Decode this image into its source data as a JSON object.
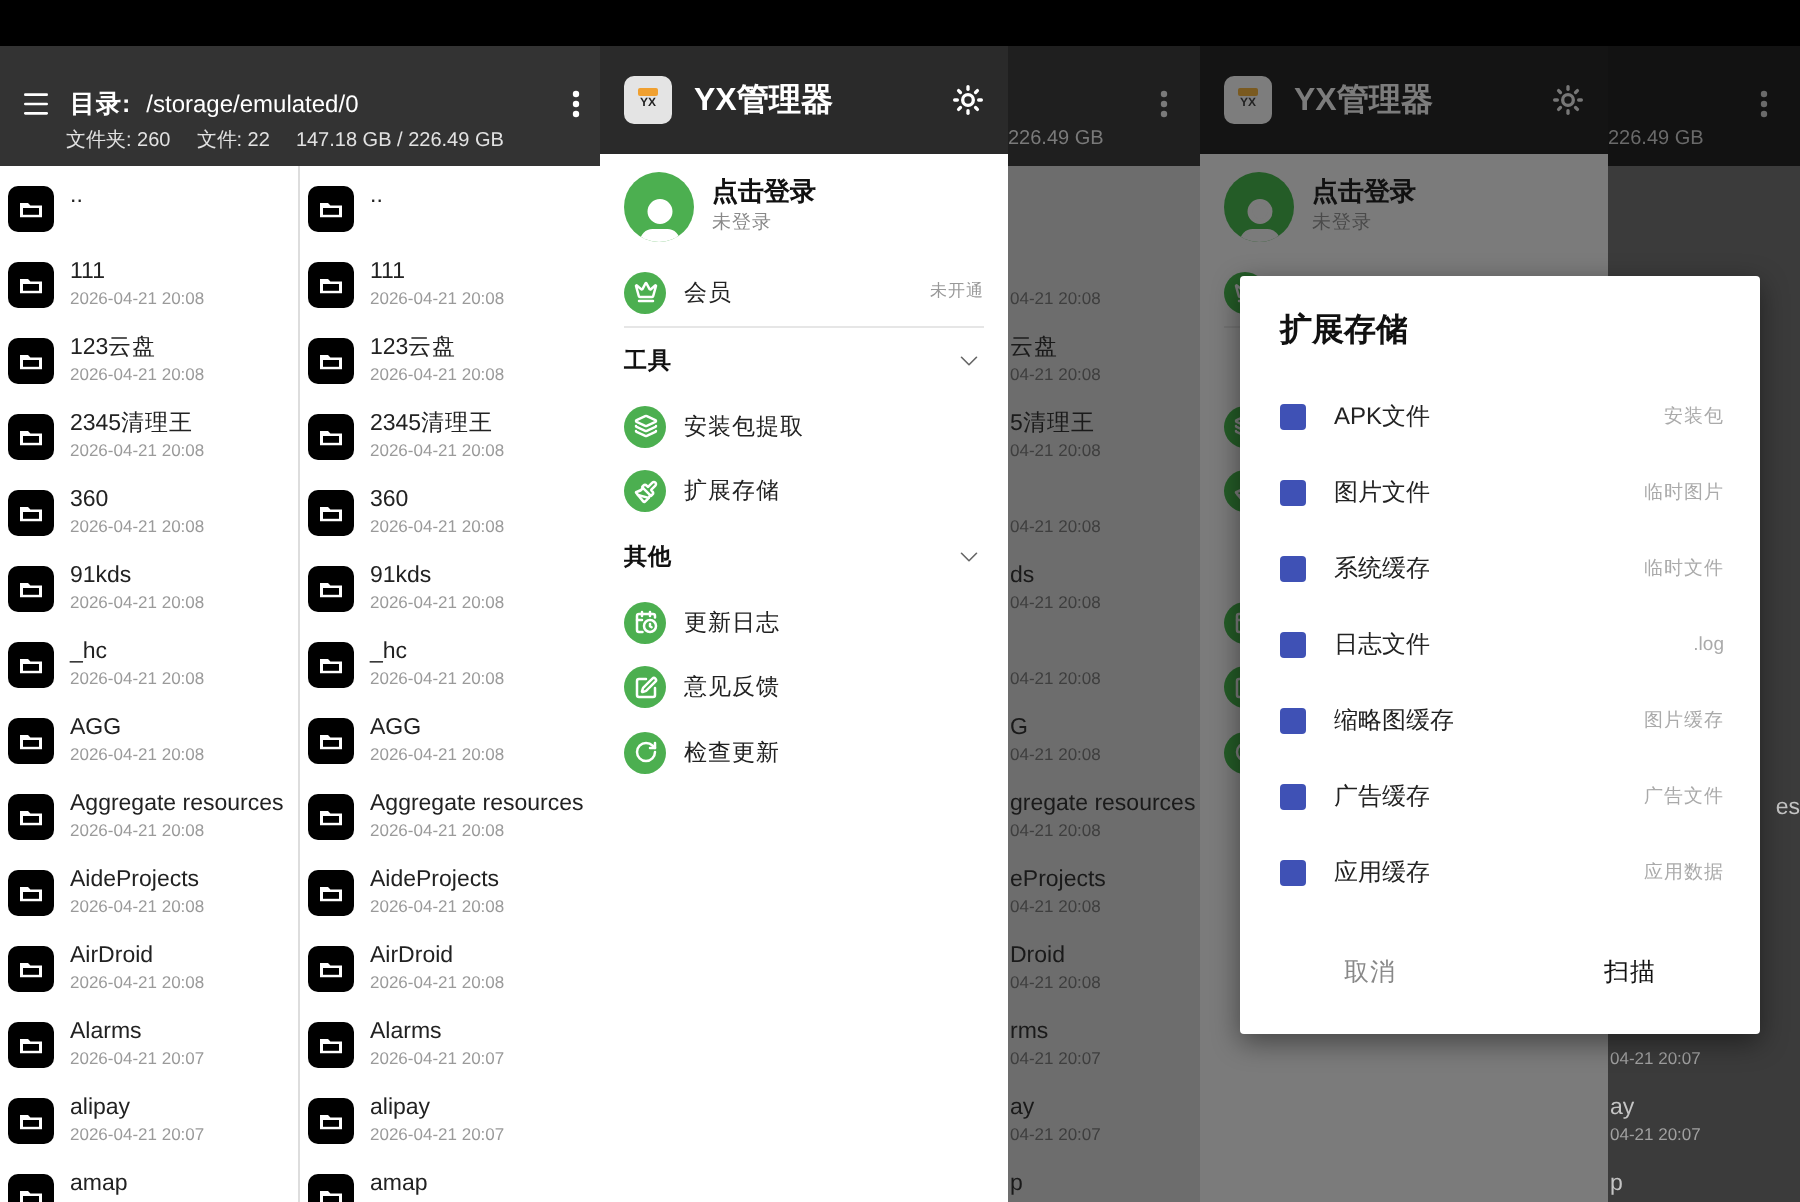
{
  "file_manager_screen": {
    "header": {
      "label": "目录:",
      "path": "/storage/emulated/0",
      "folders": "文件夹: 260",
      "files": "文件: 22",
      "storage": "147.18 GB / 226.49 GB"
    },
    "panes": [
      {
        "items": [
          {
            "name": ".."
          },
          {
            "name": "111",
            "date": "2026-04-21 20:08"
          },
          {
            "name": "123云盘",
            "date": "2026-04-21 20:08"
          },
          {
            "name": "2345清理王",
            "date": "2026-04-21 20:08"
          },
          {
            "name": "360",
            "date": "2026-04-21 20:08"
          },
          {
            "name": "91kds",
            "date": "2026-04-21 20:08"
          },
          {
            "name": "_hc",
            "date": "2026-04-21 20:08"
          },
          {
            "name": "AGG",
            "date": "2026-04-21 20:08"
          },
          {
            "name": "Aggregate resources",
            "date": "2026-04-21 20:08"
          },
          {
            "name": "AideProjects",
            "date": "2026-04-21 20:08"
          },
          {
            "name": "AirDroid",
            "date": "2026-04-21 20:08"
          },
          {
            "name": "Alarms",
            "date": "2026-04-21 20:07"
          },
          {
            "name": "alipay",
            "date": "2026-04-21 20:07"
          },
          {
            "name": "amap"
          }
        ]
      },
      {
        "items": [
          {
            "name": ".."
          },
          {
            "name": "111",
            "date": "2026-04-21 20:08"
          },
          {
            "name": "123云盘",
            "date": "2026-04-21 20:08"
          },
          {
            "name": "2345清理王",
            "date": "2026-04-21 20:08"
          },
          {
            "name": "360",
            "date": "2026-04-21 20:08"
          },
          {
            "name": "91kds",
            "date": "2026-04-21 20:08"
          },
          {
            "name": "_hc",
            "date": "2026-04-21 20:08"
          },
          {
            "name": "AGG",
            "date": "2026-04-21 20:08"
          },
          {
            "name": "Aggregate resources",
            "date": "2026-04-21 20:08"
          },
          {
            "name": "AideProjects",
            "date": "2026-04-21 20:08"
          },
          {
            "name": "AirDroid",
            "date": "2026-04-21 20:08"
          },
          {
            "name": "Alarms",
            "date": "2026-04-21 20:07"
          },
          {
            "name": "alipay",
            "date": "2026-04-21 20:07"
          },
          {
            "name": "amap"
          }
        ]
      }
    ]
  },
  "drawer_screen": {
    "drawer": {
      "logo_text": "YX",
      "app_name": "YX管理器",
      "account": {
        "title": "点击登录",
        "subtitle": "未登录"
      },
      "member": {
        "label": "会员",
        "status": "未开通"
      },
      "sections": [
        {
          "title": "工具",
          "expanded": true,
          "items": [
            "安装包提取",
            "扩展存储"
          ]
        },
        {
          "title": "其他",
          "expanded": true,
          "items": [
            "更新日志",
            "意见反馈",
            "检查更新"
          ]
        }
      ]
    },
    "background": {
      "storage": "226.49 GB",
      "rows": [
        {
          "date": "04-21 20:08"
        },
        {
          "name": "云盘",
          "date": "04-21 20:08"
        },
        {
          "name": "5清理王",
          "date": "04-21 20:08"
        },
        {
          "date": "04-21 20:08"
        },
        {
          "name": "ds",
          "date": "04-21 20:08"
        },
        {
          "date": "04-21 20:08"
        },
        {
          "name": "G",
          "date": "04-21 20:08"
        },
        {
          "name": "gregate resources",
          "date": "04-21 20:08"
        },
        {
          "name": "eProjects",
          "date": "04-21 20:08"
        },
        {
          "name": "Droid",
          "date": "04-21 20:08"
        },
        {
          "name": "rms",
          "date": "04-21 20:07"
        },
        {
          "name": "ay",
          "date": "04-21 20:07"
        },
        {
          "name": "p"
        }
      ]
    }
  },
  "dialog_screen": {
    "drawer": {
      "logo_text": "YX",
      "app_name": "YX管理器",
      "account": {
        "title": "点击登录",
        "subtitle": "未登录"
      }
    },
    "background": {
      "storage": "226.49 GB",
      "peek": "es",
      "rows": [
        {
          "date": "04-21 20:07"
        },
        {
          "name": "ay",
          "date": "04-21 20:07"
        },
        {
          "name": "p"
        }
      ]
    },
    "dialog": {
      "title": "扩展存储",
      "options": [
        {
          "label": "APK文件",
          "hint": "安装包",
          "checked": true
        },
        {
          "label": "图片文件",
          "hint": "临时图片",
          "checked": true
        },
        {
          "label": "系统缓存",
          "hint": "临时文件",
          "checked": true
        },
        {
          "label": "日志文件",
          "hint": ".log",
          "checked": true
        },
        {
          "label": "缩略图缓存",
          "hint": "图片缓存",
          "checked": true
        },
        {
          "label": "广告缓存",
          "hint": "广告文件",
          "checked": true
        },
        {
          "label": "应用缓存",
          "hint": "应用数据",
          "checked": true
        }
      ],
      "buttons": [
        {
          "label": "取消",
          "kind": "cancel"
        },
        {
          "label": "扫描",
          "kind": "confirm"
        }
      ]
    }
  }
}
